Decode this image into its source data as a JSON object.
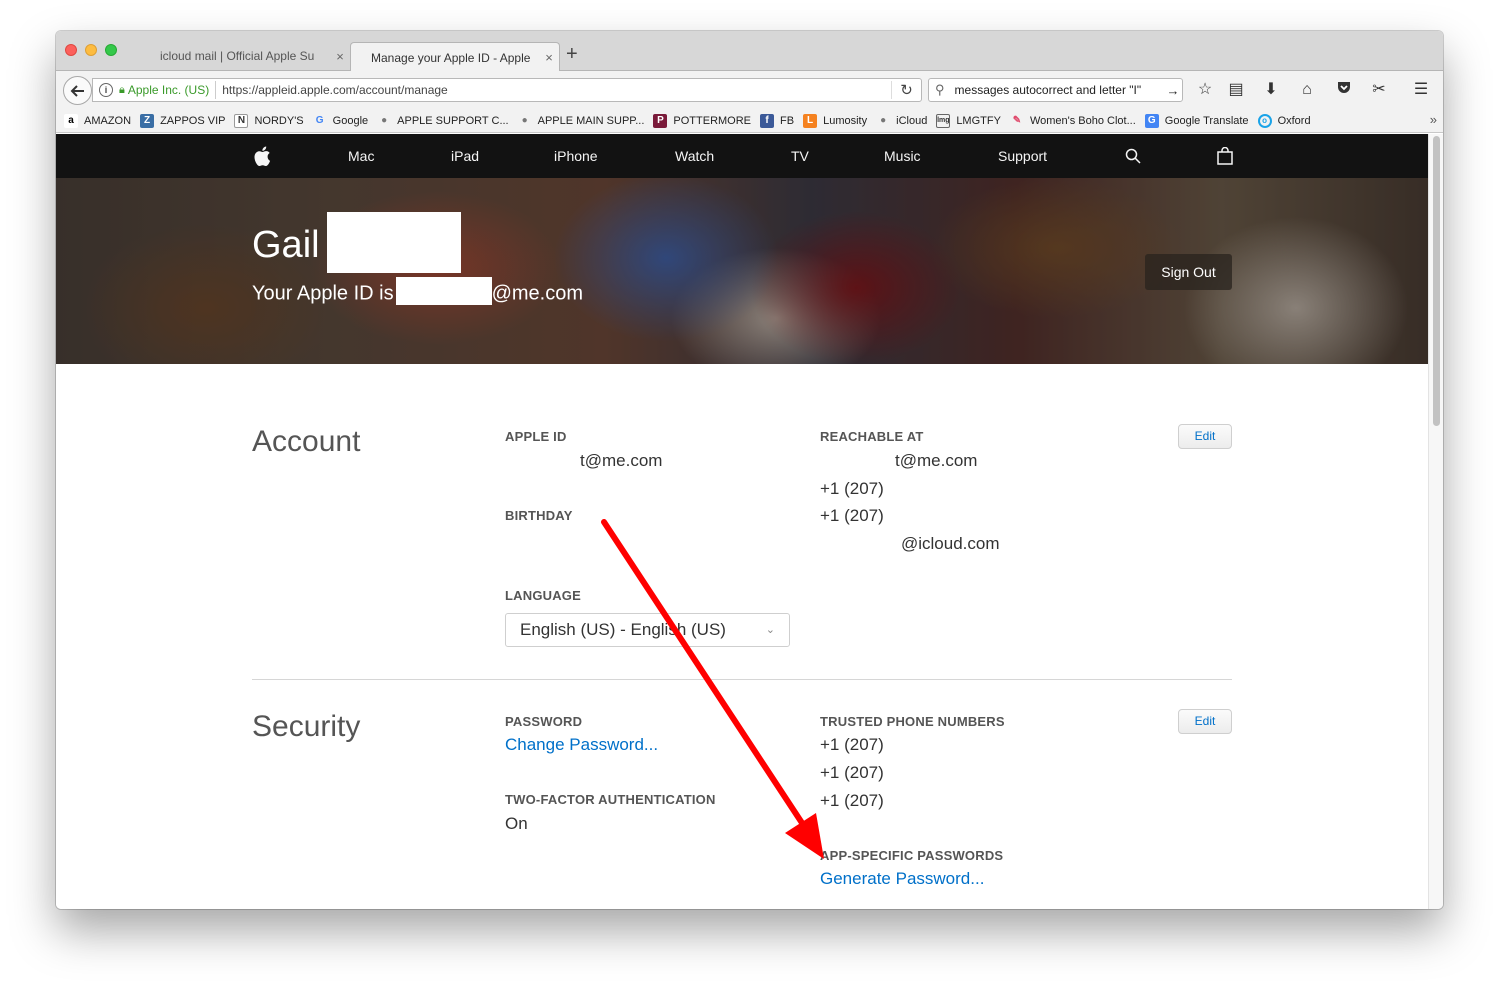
{
  "browser": {
    "tabs": [
      {
        "title": "icloud mail | Official Apple Su",
        "active": false
      },
      {
        "title": "Manage your Apple ID - Apple",
        "active": true
      }
    ],
    "new_tab_label": "+",
    "address": {
      "company": "Apple Inc. (US)",
      "url": "https://appleid.apple.com/account/manage"
    },
    "search": {
      "query": "messages autocorrect and letter \"I\""
    },
    "bookmarks": [
      {
        "label": "AMAZON",
        "icon": "amazon-icon"
      },
      {
        "label": "ZAPPOS VIP",
        "icon": "zappos-icon"
      },
      {
        "label": "NORDY'S",
        "icon": "nordstrom-icon"
      },
      {
        "label": "Google",
        "icon": "google-icon"
      },
      {
        "label": "APPLE SUPPORT C...",
        "icon": "apple-icon"
      },
      {
        "label": "APPLE MAIN SUPP...",
        "icon": "apple-icon"
      },
      {
        "label": "POTTERMORE",
        "icon": "pottermore-icon"
      },
      {
        "label": "FB",
        "icon": "facebook-icon"
      },
      {
        "label": "Lumosity",
        "icon": "lumosity-icon"
      },
      {
        "label": "iCloud",
        "icon": "apple-icon"
      },
      {
        "label": "LMGTFY",
        "icon": "lmgtfy-icon"
      },
      {
        "label": "Women's Boho Clot...",
        "icon": "boho-icon"
      },
      {
        "label": "Google Translate",
        "icon": "translate-icon"
      },
      {
        "label": "Oxford",
        "icon": "oxford-icon"
      }
    ]
  },
  "applenav": {
    "items": [
      "Mac",
      "iPad",
      "iPhone",
      "Watch",
      "TV",
      "Music",
      "Support"
    ]
  },
  "hero": {
    "first_name": "Gail",
    "apple_id_prefix": "Your Apple ID is",
    "apple_id_suffix": "@me.com",
    "sign_out": "Sign Out"
  },
  "account": {
    "title": "Account",
    "apple_id_label": "APPLE ID",
    "apple_id_value": "t@me.com",
    "birthday_label": "BIRTHDAY",
    "language_label": "LANGUAGE",
    "language_value": "English (US) - English (US)",
    "reachable_label": "REACHABLE AT",
    "reachable": [
      "t@me.com",
      "+1 (207)",
      "+1 (207)",
      "@icloud.com"
    ],
    "edit": "Edit"
  },
  "security": {
    "title": "Security",
    "password_label": "PASSWORD",
    "change_password": "Change Password...",
    "twofa_label": "TWO-FACTOR AUTHENTICATION",
    "twofa_value": "On",
    "trusted_label": "TRUSTED PHONE NUMBERS",
    "trusted": [
      "+1 (207)",
      "+1 (207)",
      "+1 (207)"
    ],
    "app_pw_label": "APP-SPECIFIC PASSWORDS",
    "generate_password": "Generate Password...",
    "edit": "Edit"
  },
  "colors": {
    "link": "#0070c9",
    "annotation_arrow": "#ff0000",
    "nav_bg": "#121212"
  }
}
